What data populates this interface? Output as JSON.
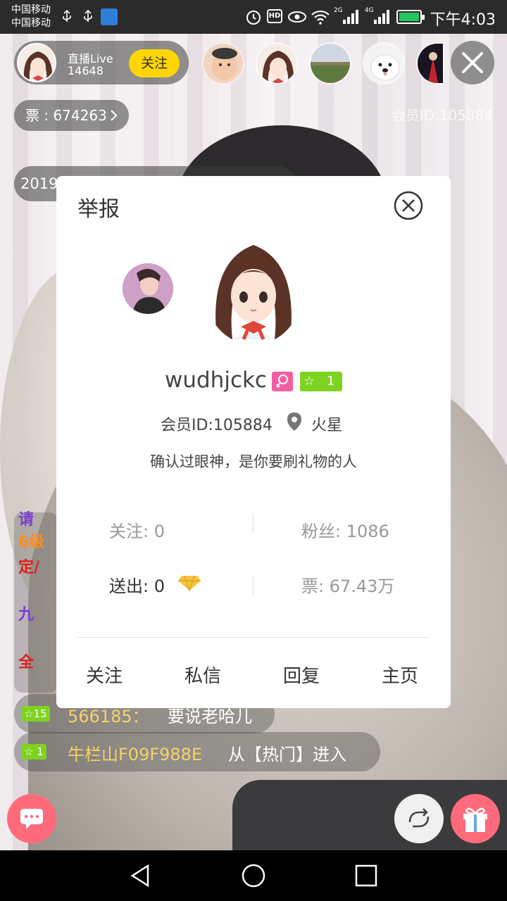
{
  "statusbar": {
    "carrier1": "中国移动",
    "carrier2": "中国移动",
    "hd": "HD",
    "net_2g": "2G",
    "net_4g": "4G",
    "time": "下午4:03"
  },
  "host": {
    "name": "直播Live",
    "count": "14648",
    "follow_label": "关注"
  },
  "tickets_label": "票 : 674263",
  "member_id_top": "会员ID:105884",
  "date_partial": "2019",
  "chat": {
    "frag1": "请",
    "frag2": "6级",
    "frag3": "定/",
    "frag4": "九",
    "frag5": "全",
    "row1": {
      "level": "15",
      "name": "566185：",
      "text": "要说老哈儿"
    },
    "row2": {
      "level": "1",
      "name": "牛栏山F09F988E",
      "text": "从【热门】进入"
    }
  },
  "dialog": {
    "title": "举报",
    "username": "wudhjckc",
    "level": "1",
    "member_id": "会员ID:105884",
    "location": "火星",
    "bio": "确认过眼神，是你要刷礼物的人",
    "stats": {
      "following": "关注: 0",
      "fans": "粉丝: 1086",
      "sent_label": "送出: 0",
      "tickets": "票: 67.43万"
    },
    "actions": {
      "follow": "关注",
      "message": "私信",
      "reply": "回复",
      "home": "主页"
    }
  },
  "colors": {
    "accent_yellow": "#ffd600",
    "badge_green": "#7ed321",
    "badge_pink": "#f35ea3",
    "fab_pink": "#ff6b7a"
  }
}
